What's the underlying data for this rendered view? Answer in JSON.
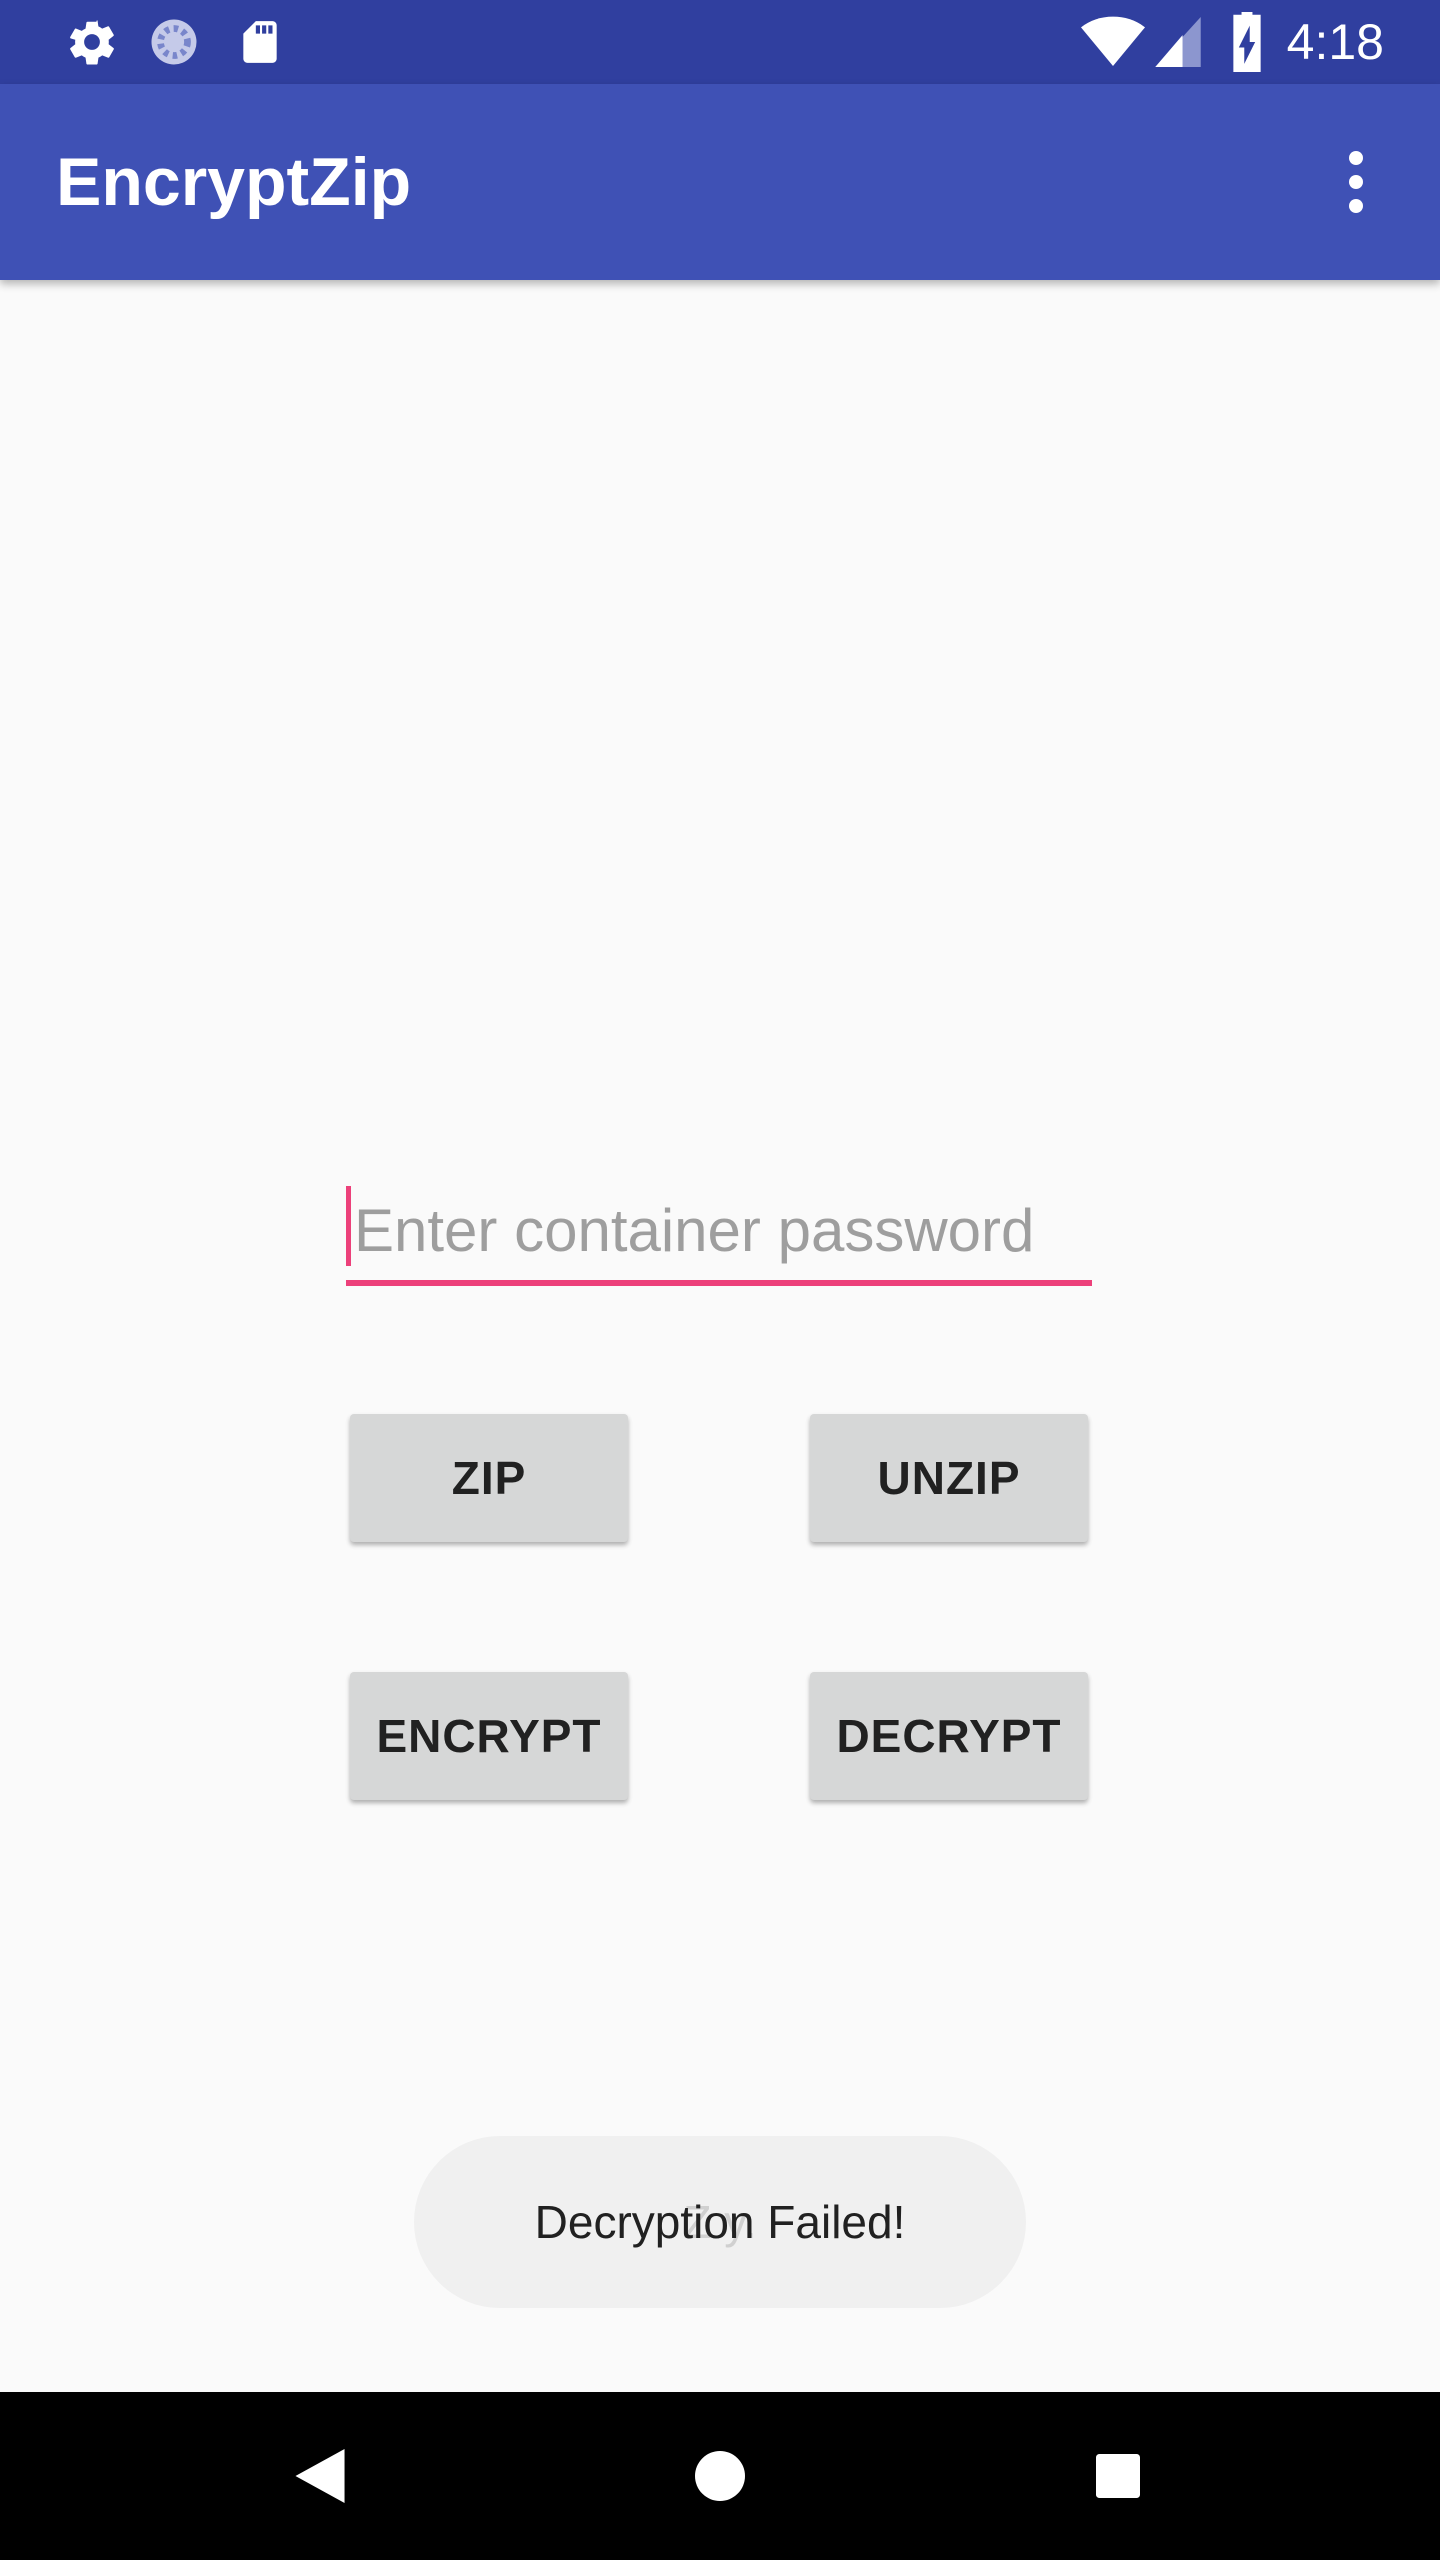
{
  "status_bar": {
    "time": "4:18",
    "left_icons": [
      "gear-icon",
      "sync-progress-icon",
      "sd-card-icon"
    ],
    "right_icons": [
      "wifi-icon",
      "cell-signal-icon",
      "battery-charging-icon"
    ]
  },
  "app_bar": {
    "title": "EncryptZip",
    "overflow_icon": "more-vert-icon"
  },
  "password_field": {
    "value": "",
    "placeholder": "Enter container password",
    "accent_color": "#ec407a"
  },
  "buttons": {
    "zip": "ZIP",
    "unzip": "UNZIP",
    "encrypt": "ENCRYPT",
    "decrypt": "DECRYPT"
  },
  "toast": {
    "message": "Decryption Failed!",
    "previous_message_fragment": "Z      y."
  },
  "nav_bar": {
    "icons": [
      "back-icon",
      "home-icon",
      "recents-icon"
    ]
  },
  "colors": {
    "status_bar": "#303f9f",
    "app_bar": "#3f51b5",
    "background": "#fafafa",
    "button": "#d6d7d7"
  }
}
